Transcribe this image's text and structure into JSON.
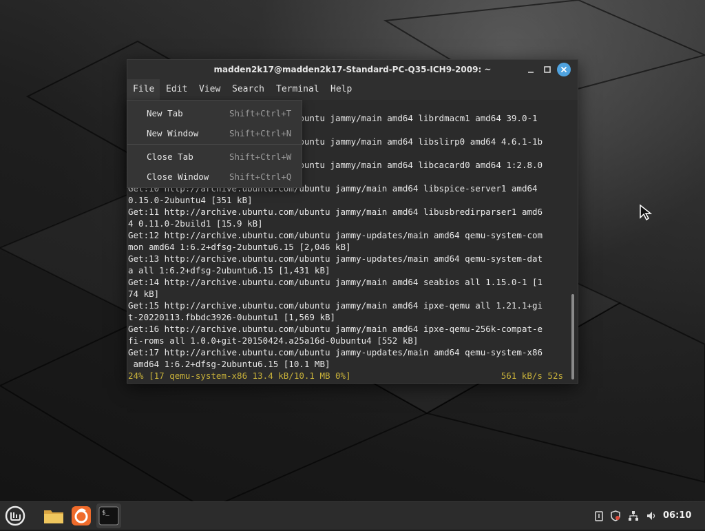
{
  "window": {
    "title": "madden2k17@madden2k17-Standard-PC-Q35-ICH9-2009: ~"
  },
  "menubar": {
    "items": [
      "File",
      "Edit",
      "View",
      "Search",
      "Terminal",
      "Help"
    ],
    "active": "File"
  },
  "file_menu": {
    "items": [
      {
        "label": "New Tab",
        "shortcut": "Shift+Ctrl+T"
      },
      {
        "label": "New Window",
        "shortcut": "Shift+Ctrl+N"
      },
      {
        "label": "Close Tab",
        "shortcut": "Shift+Ctrl+W"
      },
      {
        "label": "Close Window",
        "shortcut": "Shift+Ctrl+Q"
      }
    ]
  },
  "terminal": {
    "lines": [
      "Get:7 http://archive.ubuntu.com/ubuntu jammy/main amd64 librdmacm1 amd64 39.0-1",
      "",
      "Get:8 http://archive.ubuntu.com/ubuntu jammy/main amd64 libslirp0 amd64 4.6.1-1b",
      "",
      "Get:9 http://archive.ubuntu.com/ubuntu jammy/main amd64 libcacard0 amd64 1:2.8.0",
      "",
      "Get:10 http://archive.ubuntu.com/ubuntu jammy/main amd64 libspice-server1 amd64",
      "0.15.0-2ubuntu4 [351 kB]",
      "Get:11 http://archive.ubuntu.com/ubuntu jammy/main amd64 libusbredirparser1 amd6",
      "4 0.11.0-2build1 [15.9 kB]",
      "Get:12 http://archive.ubuntu.com/ubuntu jammy-updates/main amd64 qemu-system-com",
      "mon amd64 1:6.2+dfsg-2ubuntu6.15 [2,046 kB]",
      "Get:13 http://archive.ubuntu.com/ubuntu jammy-updates/main amd64 qemu-system-dat",
      "a all 1:6.2+dfsg-2ubuntu6.15 [1,431 kB]",
      "Get:14 http://archive.ubuntu.com/ubuntu jammy/main amd64 seabios all 1.15.0-1 [1",
      "74 kB]",
      "Get:15 http://archive.ubuntu.com/ubuntu jammy/main amd64 ipxe-qemu all 1.21.1+gi",
      "t-20220113.fbbdc3926-0ubuntu1 [1,569 kB]",
      "Get:16 http://archive.ubuntu.com/ubuntu jammy/main amd64 ipxe-qemu-256k-compat-e",
      "fi-roms all 1.0.0+git-20150424.a25a16d-0ubuntu4 [552 kB]",
      "Get:17 http://archive.ubuntu.com/ubuntu jammy-updates/main amd64 qemu-system-x86",
      " amd64 1:6.2+dfsg-2ubuntu6.15 [10.1 MB]"
    ],
    "status_left": "24% [17 qemu-system-x86 13.4 kB/10.1 MB 0%]",
    "status_right": "561 kB/s 52s"
  },
  "taskbar": {
    "clock": "06:10",
    "launchers": [
      "mint-menu-icon",
      "files-icon",
      "firefox-icon",
      "terminal-icon"
    ]
  },
  "colors": {
    "status_text": "#c9b23a",
    "close_button": "#4fa3e0",
    "terminal_bg": "#2b2b2b"
  }
}
